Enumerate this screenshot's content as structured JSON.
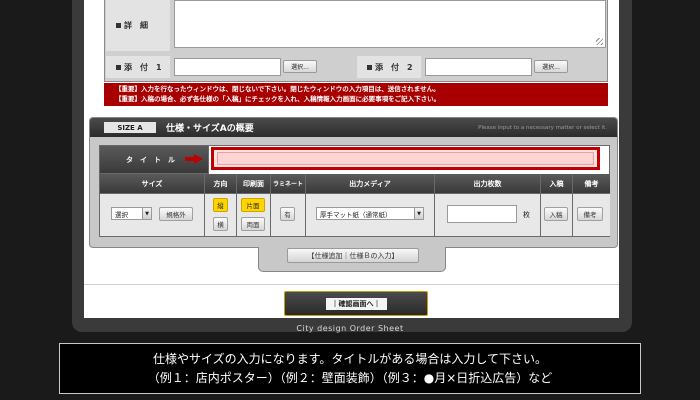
{
  "form": {
    "detail_label": "詳　細",
    "attach1_label": "添　付　1",
    "attach2_label": "添　付　2",
    "browse_label": "選択..."
  },
  "notice": {
    "line1": "【重要】入力を行なったウィンドウは、閉じないで下さい。閉じたウィンドウの入力項目は、送信されません。",
    "line2": "【重要】入稿の場合、必ず各仕様の「入稿」にチェックを入れ、入稿情報入力画面に必要事項をご記入下さい。"
  },
  "panel": {
    "size_tag": "SIZE A",
    "title": "仕様・サイズAの概要",
    "hint": "Please input to a necessary matter or select it."
  },
  "grid": {
    "title_label": "タイトル",
    "headers": {
      "size": "サイズ",
      "direction": "方向",
      "print_side": "印刷面",
      "laminate": "ラミネート",
      "media": "出力メディア",
      "qty": "出力枚数",
      "submit": "入稿",
      "notes": "備考"
    },
    "size_select": "選択",
    "nonstandard": "規格外",
    "dir_vertical": "縦",
    "dir_horizontal": "横",
    "one_side": "片面",
    "two_side": "両面",
    "laminate_btn": "有",
    "media_select": "厚手マット紙（通常紙）",
    "qty_unit": "枚",
    "submit_btn": "入稿",
    "notes_btn": "備考"
  },
  "add_spec_label": "【仕様追加｜仕様Ｂの入力】",
  "confirm_label": "｜確認画面へ｜",
  "footer": "City design Order Sheet",
  "caption": {
    "line1": "仕様やサイズの入力になります。タイトルがある場合は入力して下さい。",
    "line2": "（例１：店内ポスター）（例２：壁面装飾）（例３：●月×日折込広告）など"
  },
  "colors": {
    "highlight": "#c00000",
    "active_button": "#ffd400",
    "notice_bg": "#a80000"
  }
}
